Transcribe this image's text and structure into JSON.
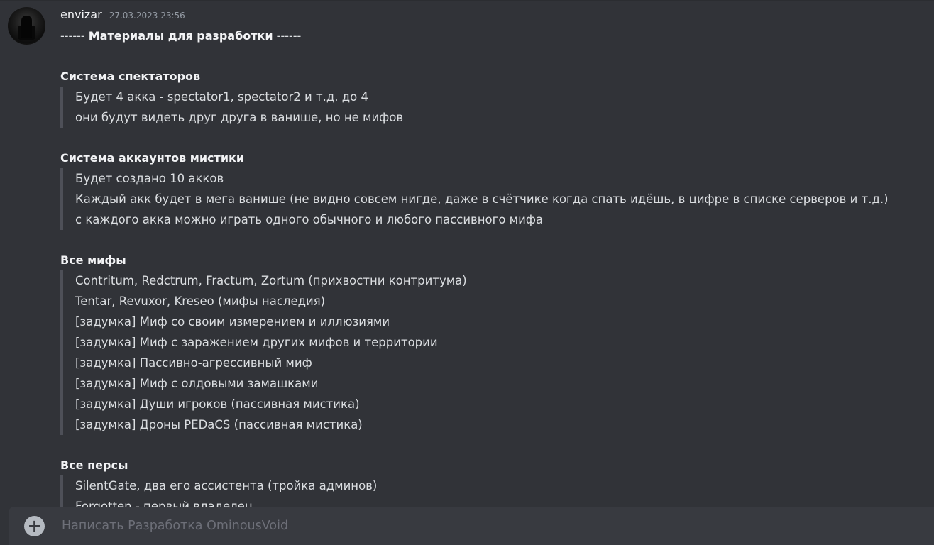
{
  "message": {
    "author": "envizar",
    "timestamp": "27.03.2023 23:56",
    "heading": {
      "prefix": "------ ",
      "title": "Материалы для разработки",
      "suffix": " ------"
    },
    "sections": [
      {
        "title": "Система спектаторов",
        "lines": [
          "Будет 4 акка - spectator1, spectator2 и т.д. до 4",
          "они будут видеть друг друга в ванише, но не мифов"
        ]
      },
      {
        "title": "Система аккаунтов мистики",
        "lines": [
          "Будет создано 10 акков",
          "Каждый акк будет в мега ванише (не видно совсем нигде, даже в счётчике когда спать идёшь, в цифре в списке серверов и т.д.)",
          "с каждого акка можно играть одного обычного и любого пассивного мифа"
        ]
      },
      {
        "title": "Все мифы",
        "lines": [
          "Contritum, Redctrum, Fractum, Zortum (прихвостни контритума)",
          "Tentar, Revuxor, Kreseo (мифы наследия)",
          "[задумка] Миф со своим измерением и иллюзиями",
          "[задумка] Миф с заражением других мифов и территории",
          "[задумка] Пассивно-агрессивный миф",
          "[задумка] Миф с олдовыми замашками",
          "[задумка] Души игроков (пассивная мистика)",
          "[задумка] Дроны PEDaCS (пассивная мистика)"
        ]
      },
      {
        "title": "Все персы",
        "lines": [
          "SilentGate, два его ассистента (тройка админов)",
          "Forgotten - первый владелец"
        ]
      }
    ]
  },
  "composer": {
    "placeholder": "Написать Разработка OminousVoid"
  },
  "icons": {
    "avatar": "user-avatar",
    "attach": "plus-circle-icon"
  },
  "colors": {
    "background": "#313338",
    "composer": "#383a40",
    "quote_bar": "#4e5058",
    "text": "#dbdee1",
    "timestamp": "#949ba4"
  }
}
